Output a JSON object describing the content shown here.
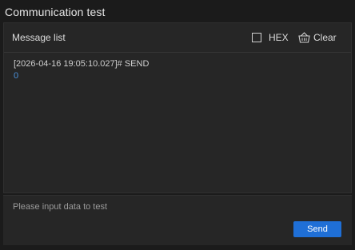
{
  "window": {
    "title": "Communication test"
  },
  "message_list": {
    "title": "Message list",
    "hex_label": "HEX",
    "hex_checked": false,
    "clear_label": "Clear",
    "messages": [
      {
        "header": "[2026-04-16 19:05:10.027]# SEND",
        "body": "0"
      }
    ]
  },
  "input": {
    "placeholder": "Please input data to test",
    "value": "",
    "send_label": "Send"
  },
  "colors": {
    "accent": "#1f6fd6",
    "message_body": "#4a90d9",
    "background": "#1b1b1b",
    "panel": "#262626"
  },
  "icons": {
    "clear": "basket-icon",
    "hex": "checkbox-icon"
  }
}
